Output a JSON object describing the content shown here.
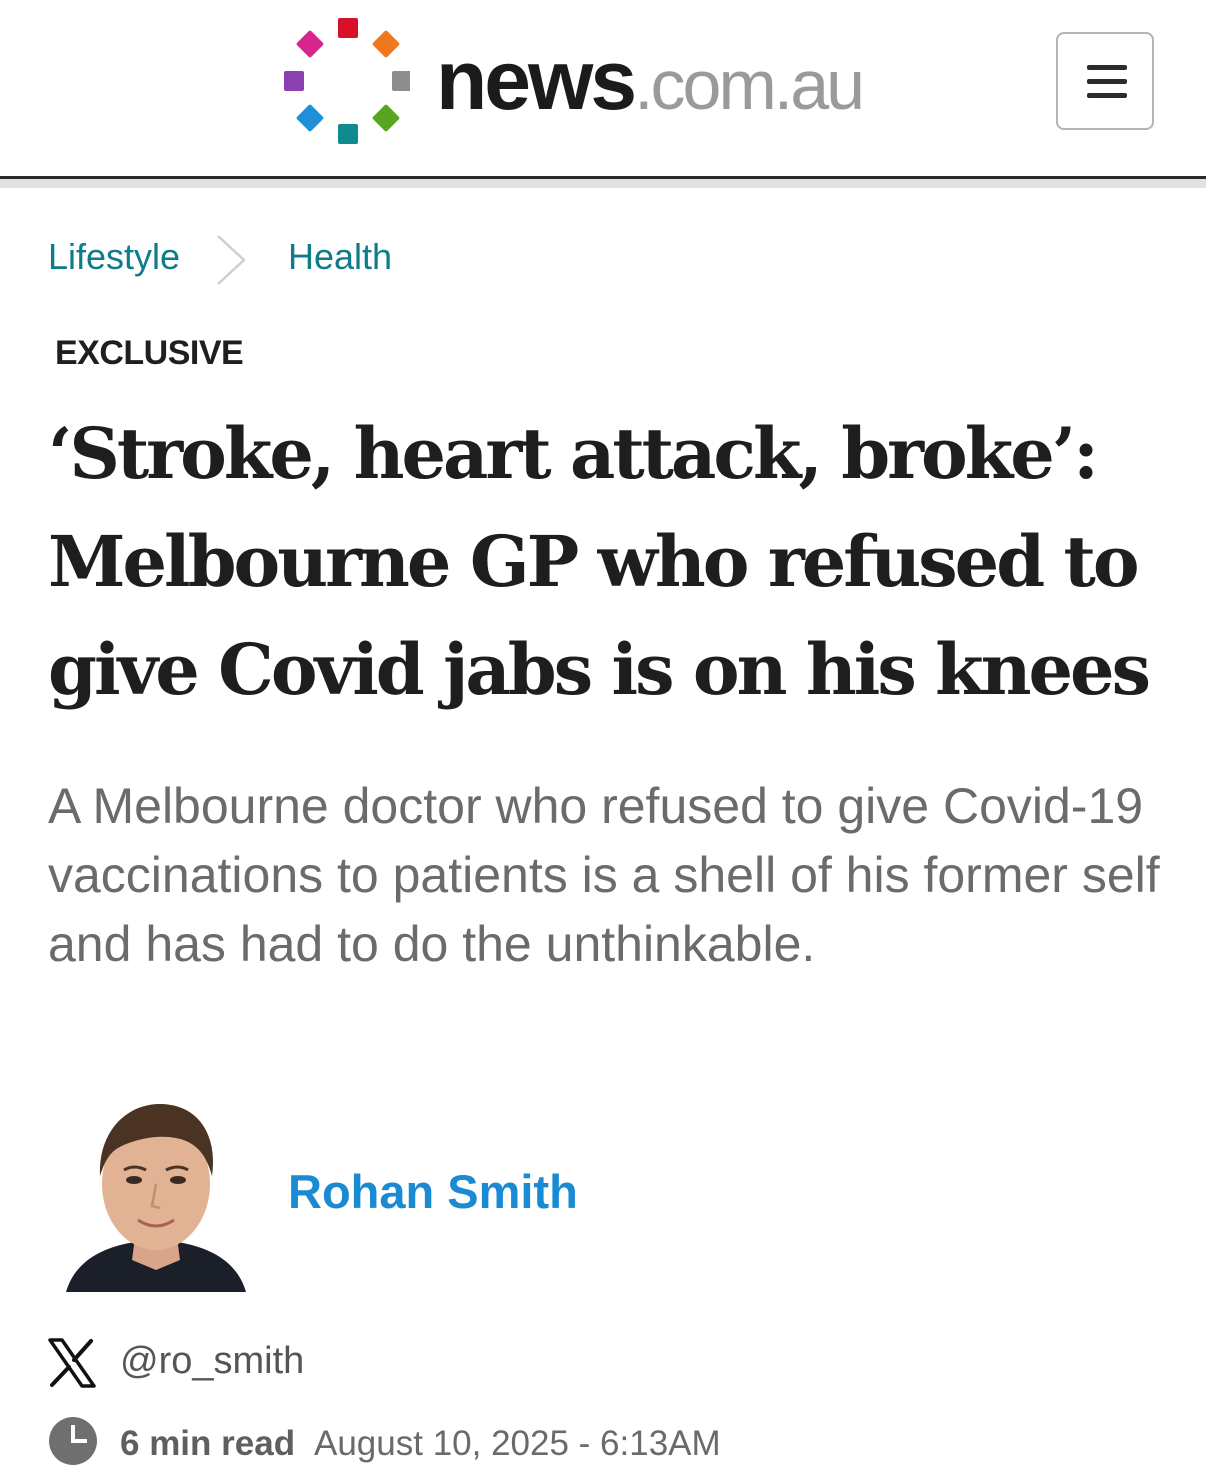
{
  "header": {
    "logo_primary": "news",
    "logo_domain": ".com.au",
    "logo_dot_colors": [
      "#d8102a",
      "#f1771e",
      "#8d8d8d",
      "#58a61f",
      "#0f8b8f",
      "#1e8fd8",
      "#8c3fb0",
      "#d8258e"
    ],
    "menu_icon": "hamburger-icon"
  },
  "breadcrumb": {
    "items": [
      {
        "label": "Lifestyle"
      },
      {
        "label": "Health"
      }
    ],
    "separator_icon": "chevron-right-icon"
  },
  "article": {
    "kicker": "EXCLUSIVE",
    "headline": "‘Stroke, heart attack, broke’: Melbourne GP who refused to give Covid jabs is on his knees",
    "standfirst": "A Melbourne doctor who refused to give Covid-19 vaccinations to patients is a shell of his former self and has had to do the unthinkable.",
    "author": {
      "name": "Rohan Smith",
      "social_icon": "x-logo-icon",
      "handle": "@ro_smith"
    },
    "meta": {
      "clock_icon": "clock-icon",
      "read_time": "6 min read",
      "published": "August 10, 2025 - 6:13AM"
    }
  },
  "colors": {
    "breadcrumb_link": "#0f7c89",
    "author_link": "#1a8ad2",
    "standfirst_text": "#6b6b6b"
  }
}
